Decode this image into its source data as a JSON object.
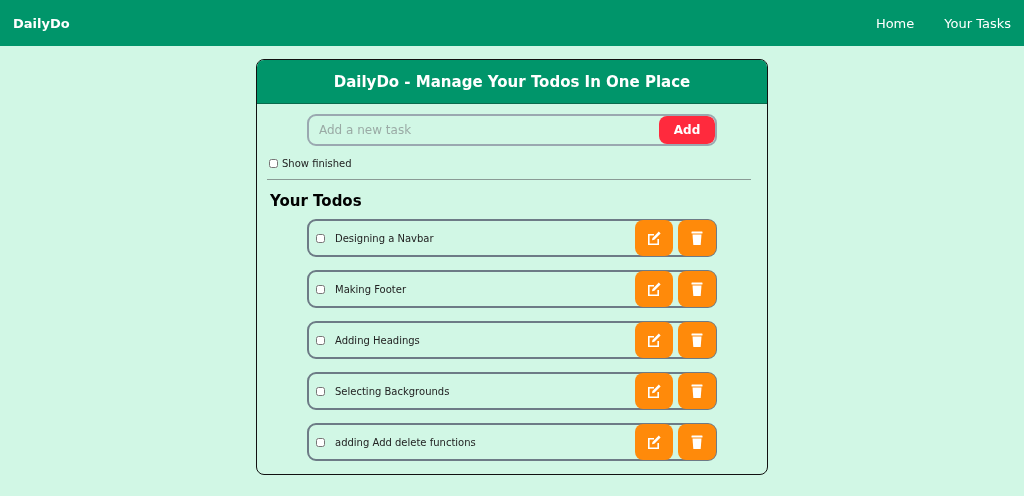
{
  "navbar": {
    "brand": "DailyDo",
    "links": [
      "Home",
      "Your Tasks"
    ]
  },
  "card": {
    "title": "DailyDo - Manage Your Todos In One Place",
    "new_task": {
      "placeholder": "Add a new task",
      "button": "Add"
    },
    "show_finished": {
      "label": "Show finished",
      "checked": false
    },
    "heading": "Your Todos",
    "todos": [
      {
        "text": "Designing a Navbar",
        "checked": false
      },
      {
        "text": "Making Footer",
        "checked": false
      },
      {
        "text": "Adding Headings",
        "checked": false
      },
      {
        "text": "Selecting Backgrounds",
        "checked": false
      },
      {
        "text": "adding Add delete functions",
        "checked": false
      }
    ]
  }
}
